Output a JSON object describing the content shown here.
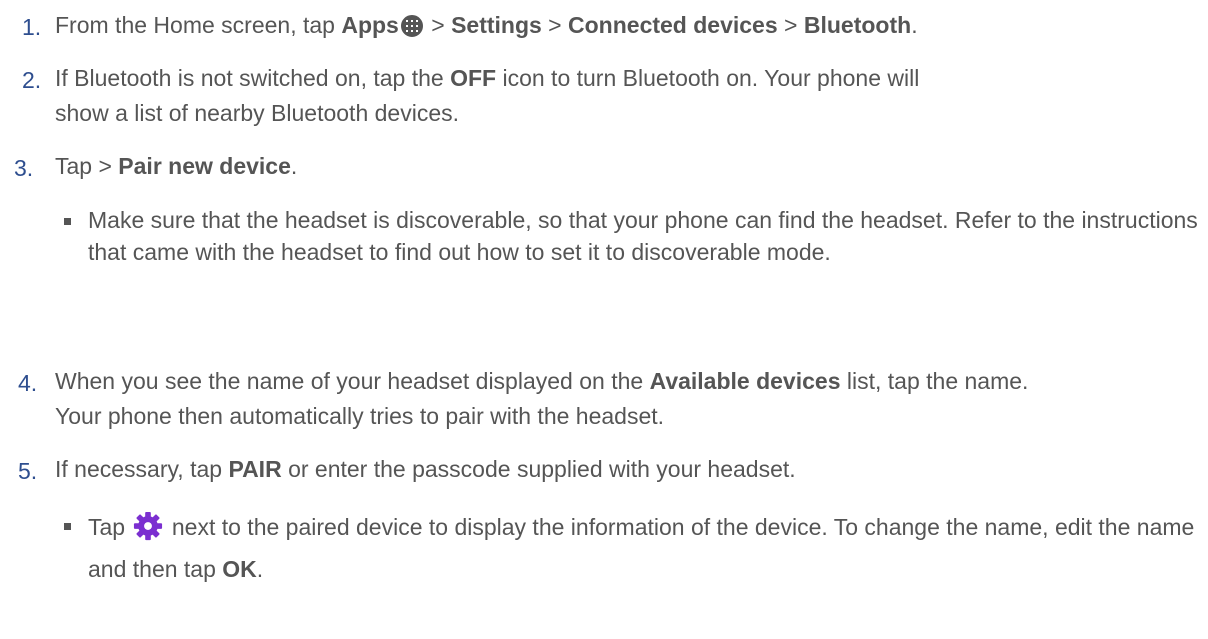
{
  "steps": [
    {
      "number": "1.",
      "parts": [
        {
          "t": "From the Home screen, tap "
        },
        {
          "b": "Apps"
        },
        {
          "icon": "apps-icon"
        },
        {
          "t": " > "
        },
        {
          "b": "Settings"
        },
        {
          "t": " > "
        },
        {
          "b": "Connected devices"
        },
        {
          "t": " > "
        },
        {
          "b": "Bluetooth"
        },
        {
          "t": "."
        }
      ]
    },
    {
      "number": "2.",
      "parts": [
        {
          "t": "If Bluetooth is not switched on, tap the "
        },
        {
          "b": "OFF"
        },
        {
          "t": " icon to turn Bluetooth on. Your phone will show a list of nearby Bluetooth devices."
        }
      ]
    },
    {
      "number": "3.",
      "parts": [
        {
          "t": "Tap > "
        },
        {
          "b": "Pair new device"
        },
        {
          "t": "."
        }
      ]
    },
    {
      "number": "4.",
      "parts": [
        {
          "t": "When you see the name of your headset displayed on the "
        },
        {
          "b": "Available devices"
        },
        {
          "t": " list, tap the name. Your phone then automatically tries to pair with the headset."
        }
      ]
    },
    {
      "number": "5.",
      "parts": [
        {
          "t": "If necessary, tap "
        },
        {
          "b": "PAIR"
        },
        {
          "t": " or enter the passcode supplied with your headset."
        }
      ]
    }
  ],
  "subs": [
    {
      "parts": [
        {
          "t": "Make sure that the headset is discoverable, so that your phone can find the headset. Refer to the instructions that came with the headset to find out how to set it to discoverable mode."
        }
      ]
    },
    {
      "parts": [
        {
          "t": "Tap "
        },
        {
          "icon": "gear-icon"
        },
        {
          "t": " next to the paired device to display the information of the device. To change the name, edit the name and then tap "
        },
        {
          "b": "OK"
        },
        {
          "t": "."
        }
      ]
    }
  ],
  "colors": {
    "number": "#2e4e8f",
    "text": "#555555",
    "gear": "#7b2fd0"
  }
}
